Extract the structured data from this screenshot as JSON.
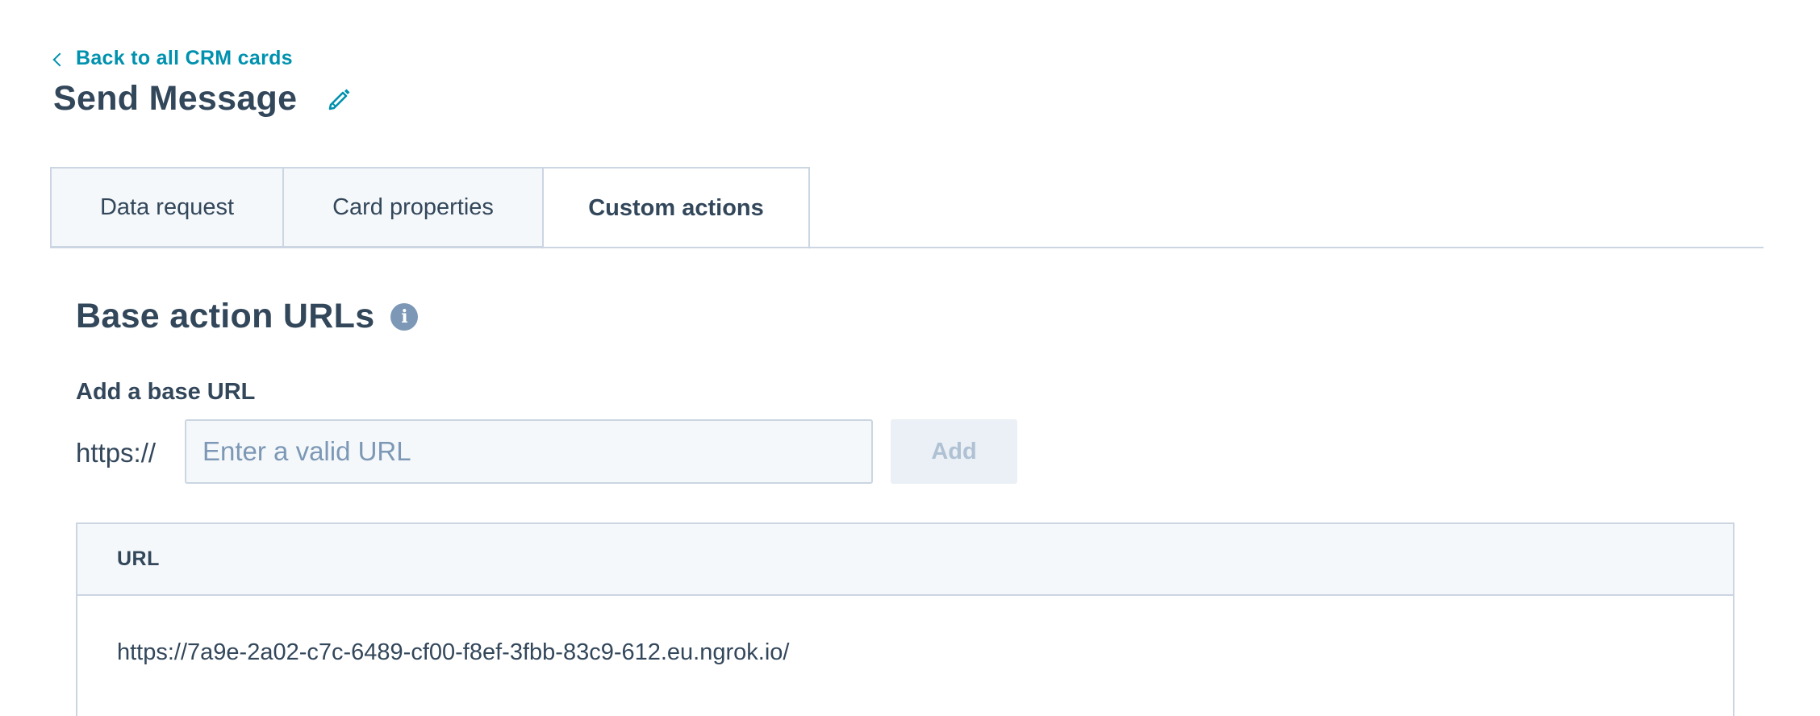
{
  "back_link": {
    "label": "Back to all CRM cards"
  },
  "header": {
    "title": "Send Message"
  },
  "tabs": [
    {
      "label": "Data request",
      "active": false
    },
    {
      "label": "Card properties",
      "active": false
    },
    {
      "label": "Custom actions",
      "active": true
    }
  ],
  "section": {
    "title": "Base action URLs",
    "info_icon": "info-icon"
  },
  "form": {
    "label": "Add a base URL",
    "prefix": "https://",
    "input_value": "",
    "input_placeholder": "Enter a valid URL",
    "add_label": "Add"
  },
  "table": {
    "columns": [
      "URL"
    ],
    "rows": [
      [
        "https://7a9e-2a02-c7c-6489-cf00-f8ef-3fbb-83c9-612.eu.ngrok.io/"
      ]
    ]
  },
  "icons": {
    "back": "chevron-left-icon",
    "edit": "pencil-icon",
    "info": "info-icon"
  },
  "colors": {
    "link": "#0091ae",
    "text": "#33475b",
    "border": "#cbd6e2",
    "muted": "#7c98b6",
    "surface": "#f5f8fa"
  }
}
